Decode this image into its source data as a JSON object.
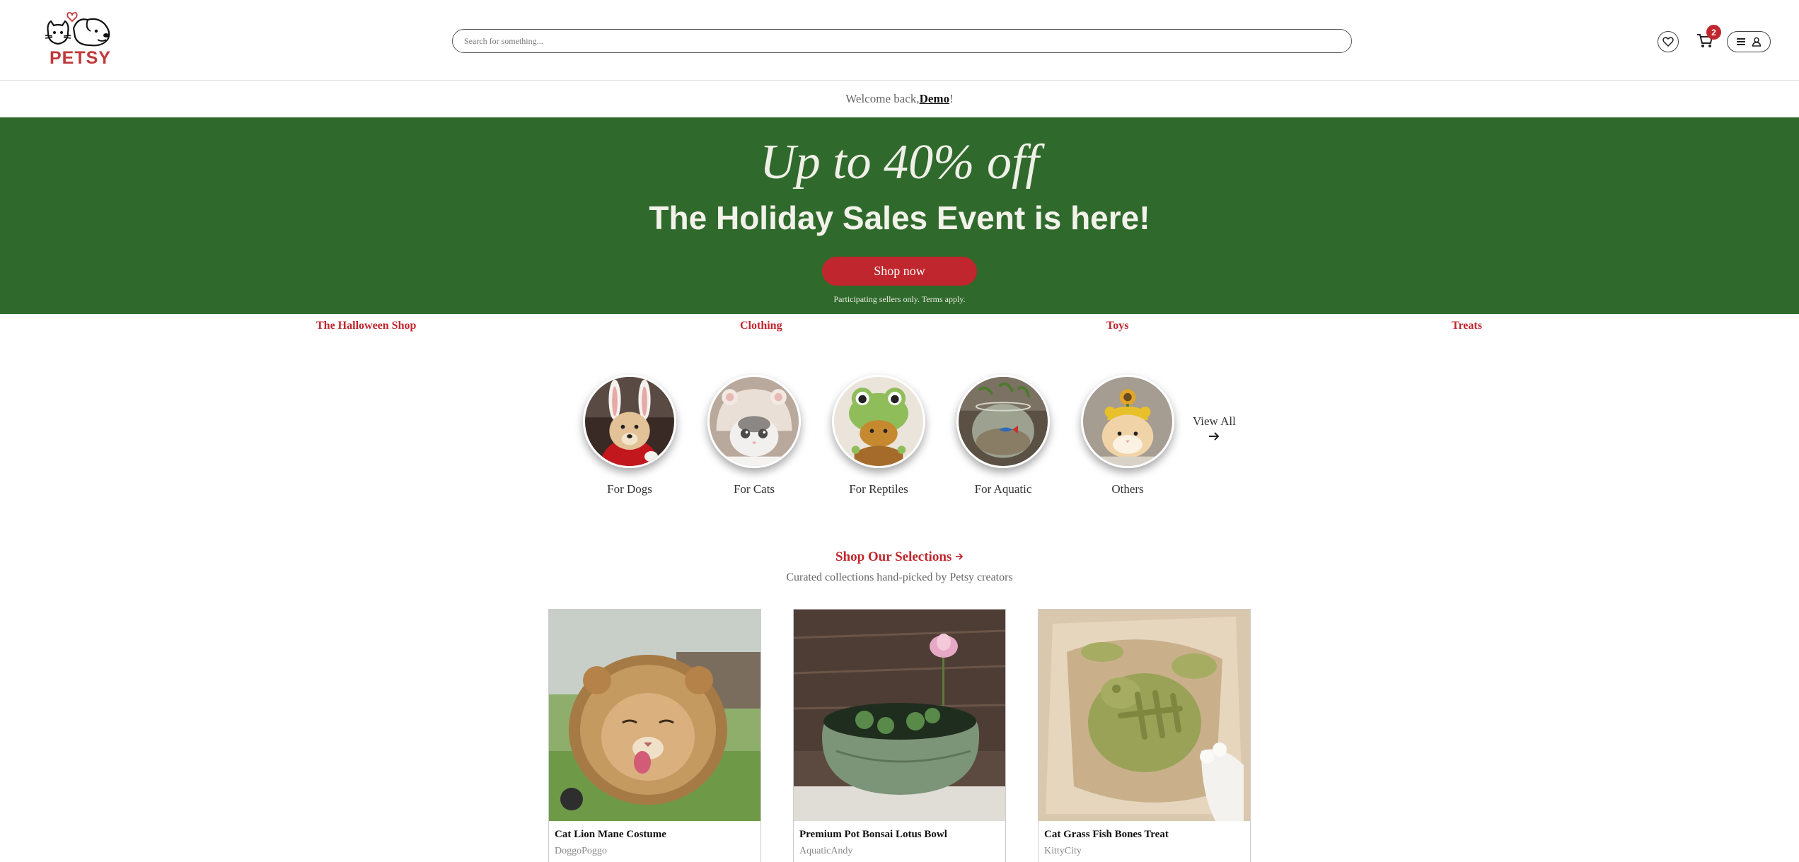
{
  "header": {
    "logo_text": "PETSY",
    "search_placeholder": "Search for something...",
    "cart_count": "2",
    "icons": [
      "heart-icon",
      "cart-icon",
      "menu-icon",
      "user-icon"
    ]
  },
  "welcome": {
    "prefix": "Welcome back, ",
    "user": "Demo",
    "suffix": "!"
  },
  "banner": {
    "discount": "Up to 40% off",
    "title": "The Holiday Sales Event is here!",
    "button": "Shop now",
    "terms": "Participating sellers only. Terms apply.",
    "background": "#2f6a2c",
    "button_color": "#c0262d"
  },
  "category_nav": [
    "The Halloween Shop",
    "Clothing",
    "Toys",
    "Treats"
  ],
  "pet_categories": [
    {
      "label": "For Dogs"
    },
    {
      "label": "For Cats"
    },
    {
      "label": "For Reptiles"
    },
    {
      "label": "For Aquatic"
    },
    {
      "label": "Others"
    }
  ],
  "view_all": {
    "label": "View All",
    "icon": "arrow-right-icon"
  },
  "selections": {
    "title": "Shop Our Selections",
    "subtitle": "Curated collections hand-picked by Petsy creators"
  },
  "products": [
    {
      "name": "Cat Lion Mane Costume",
      "seller": "DoggoPoggo"
    },
    {
      "name": "Premium Pot Bonsai Lotus Bowl",
      "seller": "AquaticAndy"
    },
    {
      "name": "Cat Grass Fish Bones Treat",
      "seller": "KittyCity"
    }
  ],
  "colors": {
    "accent": "#c0262d",
    "logo": "#c0393b"
  }
}
